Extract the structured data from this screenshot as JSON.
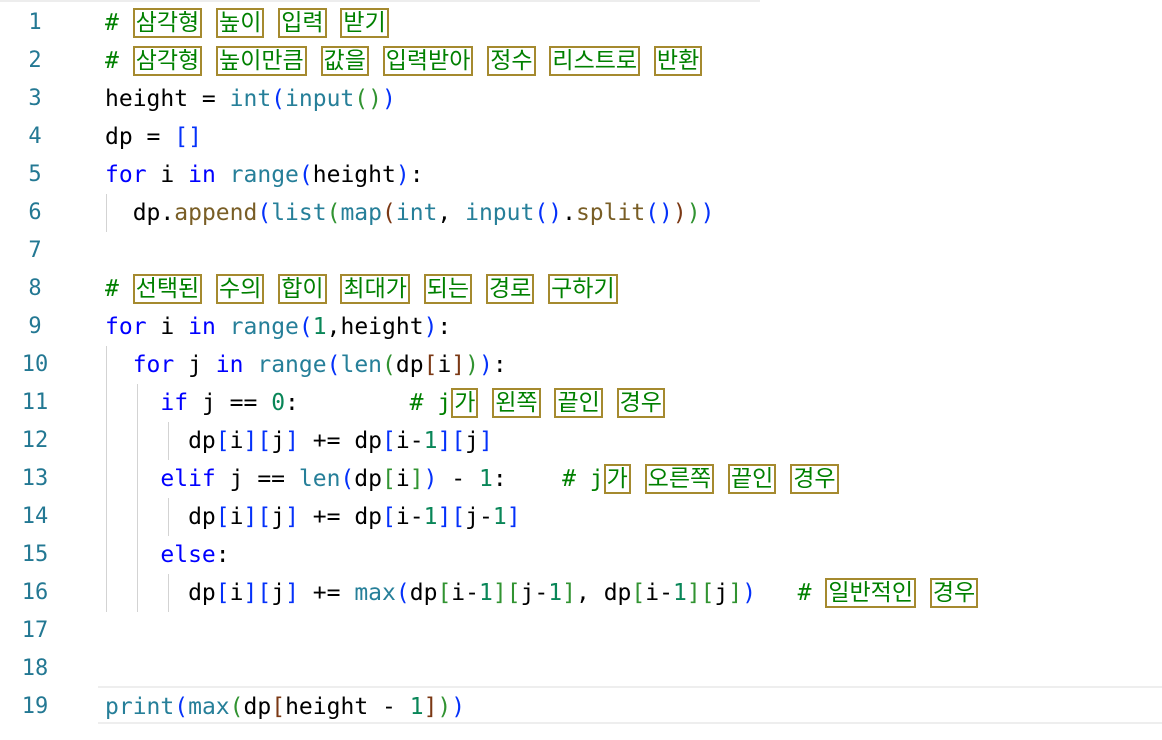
{
  "editor": {
    "line_numbers": [
      "1",
      "2",
      "3",
      "4",
      "5",
      "6",
      "7",
      "8",
      "9",
      "10",
      "11",
      "12",
      "13",
      "14",
      "15",
      "16",
      "17",
      "18",
      "19"
    ],
    "lines": [
      "# 삼각형 높이 입력 받기",
      "# 삼각형 높이만큼 값을 입력받아 정수 리스트로 반환",
      "height = int(input())",
      "dp = []",
      "for i in range(height):",
      "  dp.append(list(map(int, input().split())))",
      "",
      "# 선택된 수의 합이 최대가 되는 경로 구하기",
      "for i in range(1,height):",
      "  for j in range(len(dp[i])):",
      "    if j == 0:        # j가 왼쪽 끝인 경우",
      "      dp[i][j] += dp[i-1][j]",
      "    elif j == len(dp[i]) - 1:    # j가 오른쪽 끝인 경우",
      "      dp[i][j] += dp[i-1][j-1]",
      "    else:",
      "      dp[i][j] += max(dp[i-1][j-1], dp[i-1][j])   # 일반적인 경우",
      "",
      "",
      "print(max(dp[height - 1]))"
    ],
    "highlighted_words": [
      "삼각형",
      "높이",
      "입력",
      "받기",
      "높이만큼",
      "값을",
      "입력받아",
      "정수",
      "리스트로",
      "반환",
      "선택된",
      "수의",
      "합이",
      "최대가",
      "되는",
      "경로",
      "구하기",
      "가",
      "왼쪽",
      "끝인",
      "경우",
      "오른쪽",
      "일반적인"
    ],
    "colors": {
      "line_number": "#237893",
      "keyword": "#0000ff",
      "builtin": "#267f99",
      "function": "#795e26",
      "number": "#098658",
      "comment": "#008000",
      "highlight_border": "#a58a2f"
    }
  }
}
